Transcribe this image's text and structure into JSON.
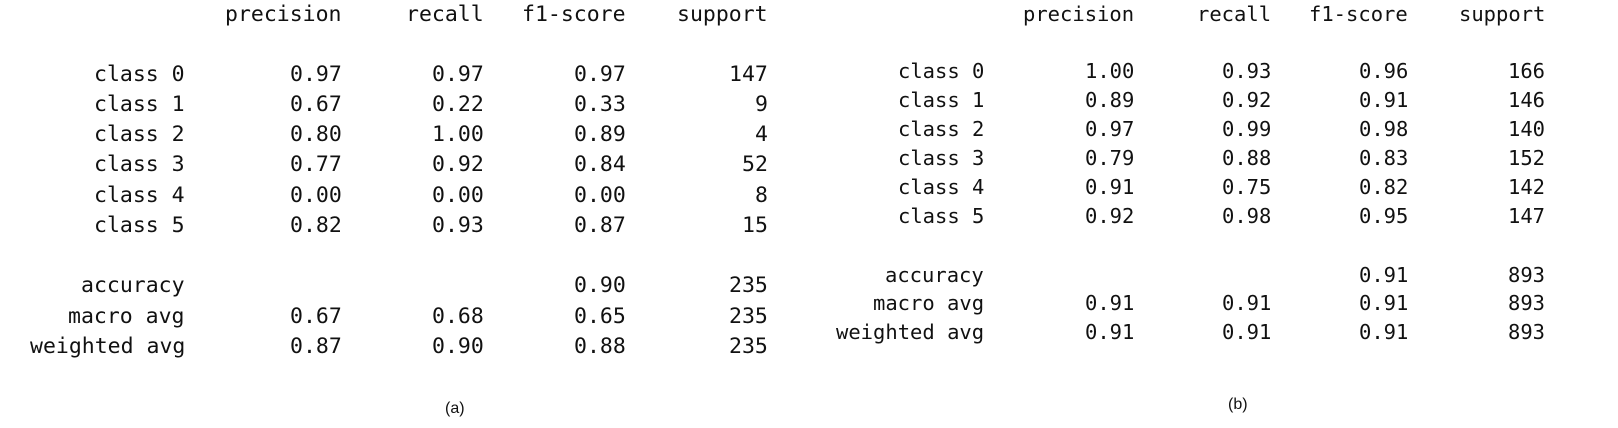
{
  "reports": [
    {
      "caption": "(a)",
      "headers": [
        "precision",
        "recall",
        "f1-score",
        "support"
      ],
      "rows": [
        {
          "label": "class 0",
          "precision": "0.97",
          "recall": "0.97",
          "f1": "0.97",
          "support": "147"
        },
        {
          "label": "class 1",
          "precision": "0.67",
          "recall": "0.22",
          "f1": "0.33",
          "support": "9"
        },
        {
          "label": "class 2",
          "precision": "0.80",
          "recall": "1.00",
          "f1": "0.89",
          "support": "4"
        },
        {
          "label": "class 3",
          "precision": "0.77",
          "recall": "0.92",
          "f1": "0.84",
          "support": "52"
        },
        {
          "label": "class 4",
          "precision": "0.00",
          "recall": "0.00",
          "f1": "0.00",
          "support": "8"
        },
        {
          "label": "class 5",
          "precision": "0.82",
          "recall": "0.93",
          "f1": "0.87",
          "support": "15"
        },
        {
          "label": "accuracy",
          "precision": "",
          "recall": "",
          "f1": "0.90",
          "support": "235"
        },
        {
          "label": "macro avg",
          "precision": "0.67",
          "recall": "0.68",
          "f1": "0.65",
          "support": "235"
        },
        {
          "label": "weighted avg",
          "precision": "0.87",
          "recall": "0.90",
          "f1": "0.88",
          "support": "235"
        }
      ]
    },
    {
      "caption": "(b)",
      "headers": [
        "precision",
        "recall",
        "f1-score",
        "support"
      ],
      "rows": [
        {
          "label": "class 0",
          "precision": "1.00",
          "recall": "0.93",
          "f1": "0.96",
          "support": "166"
        },
        {
          "label": "class 1",
          "precision": "0.89",
          "recall": "0.92",
          "f1": "0.91",
          "support": "146"
        },
        {
          "label": "class 2",
          "precision": "0.97",
          "recall": "0.99",
          "f1": "0.98",
          "support": "140"
        },
        {
          "label": "class 3",
          "precision": "0.79",
          "recall": "0.88",
          "f1": "0.83",
          "support": "152"
        },
        {
          "label": "class 4",
          "precision": "0.91",
          "recall": "0.75",
          "f1": "0.82",
          "support": "142"
        },
        {
          "label": "class 5",
          "precision": "0.92",
          "recall": "0.98",
          "f1": "0.95",
          "support": "147"
        },
        {
          "label": "accuracy",
          "precision": "",
          "recall": "",
          "f1": "0.91",
          "support": "893"
        },
        {
          "label": "macro avg",
          "precision": "0.91",
          "recall": "0.91",
          "f1": "0.91",
          "support": "893"
        },
        {
          "label": "weighted avg",
          "precision": "0.91",
          "recall": "0.91",
          "f1": "0.91",
          "support": "893"
        }
      ]
    }
  ]
}
